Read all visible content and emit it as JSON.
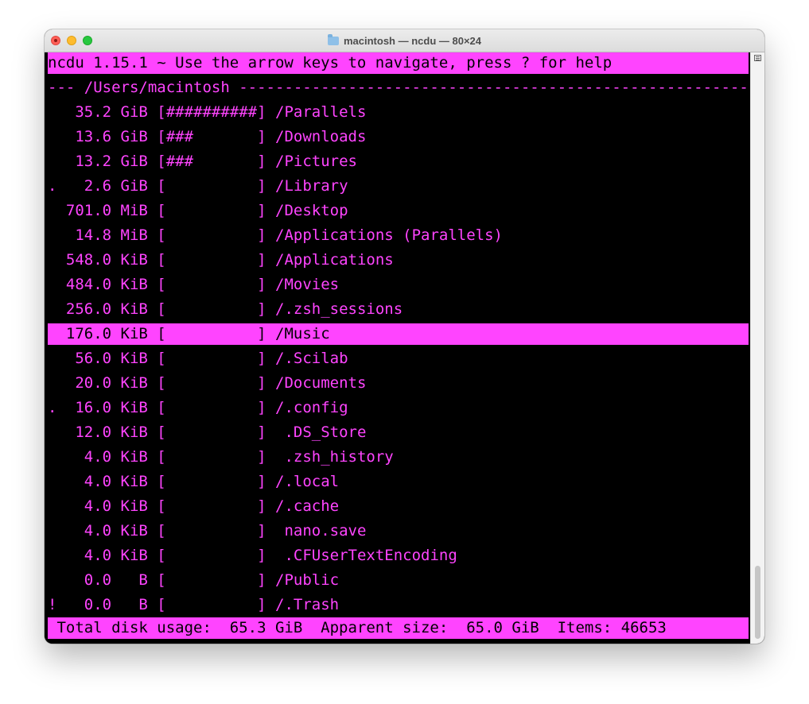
{
  "window": {
    "title": "macintosh — ncdu — 80×24"
  },
  "terminal": {
    "header": "ncdu 1.15.1 ~ Use the arrow keys to navigate, press ? for help",
    "path_line": "--- /Users/macintosh -------------------------------------------------------------",
    "rows": [
      {
        "flag": " ",
        "size": "  35.2 GiB",
        "bar": "##########",
        "name": "/Parallels"
      },
      {
        "flag": " ",
        "size": "  13.6 GiB",
        "bar": "###       ",
        "name": "/Downloads"
      },
      {
        "flag": " ",
        "size": "  13.2 GiB",
        "bar": "###       ",
        "name": "/Pictures"
      },
      {
        "flag": ".",
        "size": "   2.6 GiB",
        "bar": "          ",
        "name": "/Library"
      },
      {
        "flag": " ",
        "size": " 701.0 MiB",
        "bar": "          ",
        "name": "/Desktop"
      },
      {
        "flag": " ",
        "size": "  14.8 MiB",
        "bar": "          ",
        "name": "/Applications (Parallels)"
      },
      {
        "flag": " ",
        "size": " 548.0 KiB",
        "bar": "          ",
        "name": "/Applications"
      },
      {
        "flag": " ",
        "size": " 484.0 KiB",
        "bar": "          ",
        "name": "/Movies"
      },
      {
        "flag": " ",
        "size": " 256.0 KiB",
        "bar": "          ",
        "name": "/.zsh_sessions"
      },
      {
        "flag": " ",
        "size": " 176.0 KiB",
        "bar": "          ",
        "name": "/Music",
        "selected": true
      },
      {
        "flag": " ",
        "size": "  56.0 KiB",
        "bar": "          ",
        "name": "/.Scilab"
      },
      {
        "flag": " ",
        "size": "  20.0 KiB",
        "bar": "          ",
        "name": "/Documents"
      },
      {
        "flag": ".",
        "size": "  16.0 KiB",
        "bar": "          ",
        "name": "/.config"
      },
      {
        "flag": " ",
        "size": "  12.0 KiB",
        "bar": "          ",
        "name": " .DS_Store"
      },
      {
        "flag": " ",
        "size": "   4.0 KiB",
        "bar": "          ",
        "name": " .zsh_history"
      },
      {
        "flag": " ",
        "size": "   4.0 KiB",
        "bar": "          ",
        "name": "/.local"
      },
      {
        "flag": " ",
        "size": "   4.0 KiB",
        "bar": "          ",
        "name": "/.cache"
      },
      {
        "flag": " ",
        "size": "   4.0 KiB",
        "bar": "          ",
        "name": " nano.save"
      },
      {
        "flag": " ",
        "size": "   4.0 KiB",
        "bar": "          ",
        "name": " .CFUserTextEncoding"
      },
      {
        "flag": " ",
        "size": "   0.0   B",
        "bar": "          ",
        "name": "/Public"
      },
      {
        "flag": "!",
        "size": "   0.0   B",
        "bar": "          ",
        "name": "/.Trash"
      }
    ],
    "footer": " Total disk usage:  65.3 GiB  Apparent size:  65.0 GiB  Items: 46653"
  },
  "colors": {
    "foreground": "#ff44ff",
    "background": "#000000"
  }
}
